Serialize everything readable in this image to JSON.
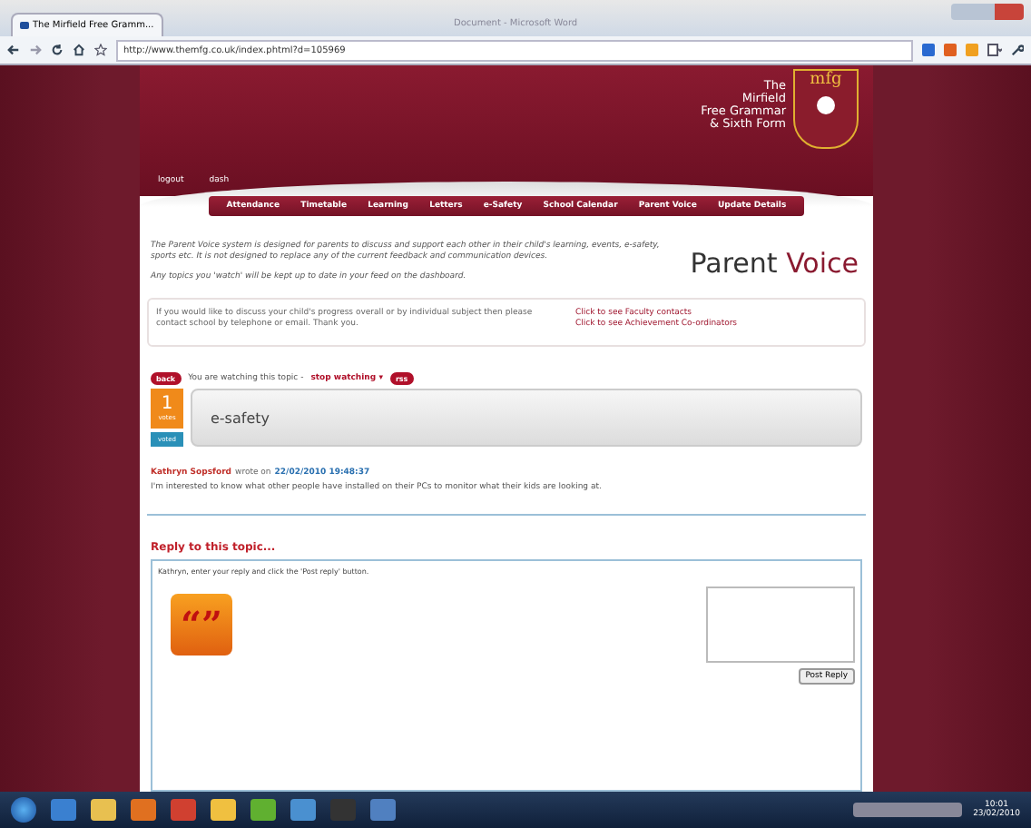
{
  "browser": {
    "tab_title": "The Mirfield Free Gramm...",
    "window_title": "Document - Microsoft Word",
    "url": "http://www.themfg.co.uk/index.phtml?d=105969"
  },
  "header": {
    "school_lines": [
      "The",
      "Mirfield",
      "Free Grammar",
      "& Sixth Form"
    ],
    "crest_text": "mfg",
    "links": [
      "logout",
      "dash"
    ]
  },
  "nav": [
    "Attendance",
    "Timetable",
    "Learning",
    "Letters",
    "e-Safety",
    "School Calendar",
    "Parent Voice",
    "Update Details"
  ],
  "intro": {
    "paragraphs": [
      "The Parent Voice system is designed for parents to discuss and support each other in their child's learning, events, e-safety, sports etc. It is not designed to replace any of the current feedback and communication devices.",
      "Any topics you 'watch' will be kept up to date in your feed on the dashboard."
    ],
    "brand_first": "Parent",
    "brand_second": "Voice"
  },
  "contact": {
    "text": "If you would like to discuss your child's progress overall or by individual subject then please contact school by telephone or email. Thank you.",
    "links": [
      "Click to see Faculty contacts",
      "Click to see Achievement Co-ordinators"
    ]
  },
  "topic": {
    "back": "back",
    "watching": "You are watching this topic -",
    "stop": "stop watching",
    "stop_caret": "▾",
    "rss": "rss",
    "votes": "1",
    "votes_label": "votes",
    "voted": "voted",
    "title": "e-safety",
    "author": "Kathryn Sopsford",
    "wrote": "wrote on",
    "date": "22/02/2010 19:48:37",
    "message": "I'm interested to know what other people have installed on their PCs to monitor what their kids are looking at."
  },
  "reply": {
    "heading": "Reply to this topic...",
    "prompt": "Kathryn, enter your reply and click the 'Post reply' button.",
    "quote": "“”",
    "button": "Post Reply"
  },
  "taskbar": {
    "time": "10:01",
    "date": "23/02/2010"
  }
}
